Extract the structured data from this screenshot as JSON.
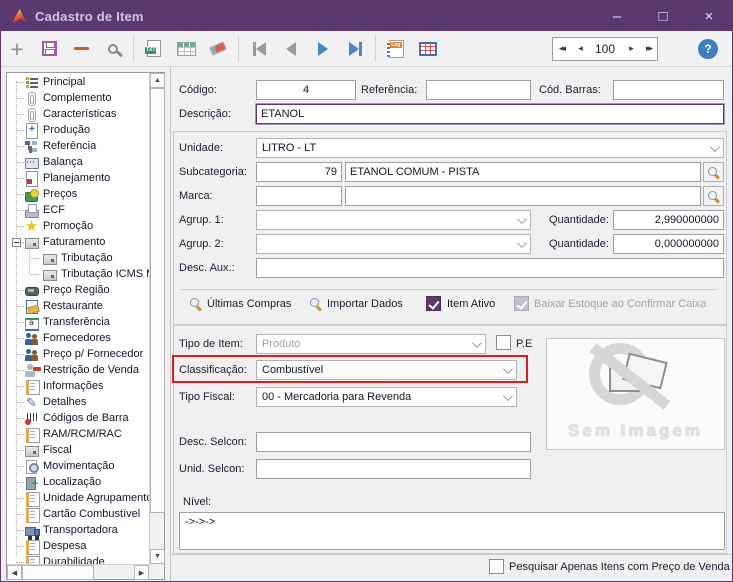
{
  "window": {
    "title": "Cadastro de Item",
    "minimize_glyph": "–",
    "maximize_glyph": "□",
    "close_glyph": "×"
  },
  "toolbar": {
    "spinner": {
      "first": "◂◂",
      "prev": "◂",
      "value": "100",
      "next": "▸",
      "last": "▸▸"
    },
    "help_glyph": "?"
  },
  "sidebar": {
    "items": [
      {
        "label": "Principal",
        "icon": "list-icon",
        "level": 0
      },
      {
        "label": "Complemento",
        "icon": "paperclip-icon",
        "level": 0
      },
      {
        "label": "Características",
        "icon": "paperclip-icon",
        "level": 0
      },
      {
        "label": "Produção",
        "icon": "production-doc-icon",
        "level": 0
      },
      {
        "label": "Referência",
        "icon": "hierarchy-icon",
        "level": 0
      },
      {
        "label": "Balança",
        "icon": "scale-icon",
        "level": 0
      },
      {
        "label": "Planejamento",
        "icon": "planning-doc-icon",
        "level": 0
      },
      {
        "label": "Preços",
        "icon": "money-icon",
        "level": 0
      },
      {
        "label": "ECF",
        "icon": "printer-icon",
        "level": 0
      },
      {
        "label": "Promoção",
        "icon": "star-icon",
        "level": 0,
        "star_glyph": "★"
      },
      {
        "label": "Faturamento",
        "icon": "invoice-icon",
        "level": 0,
        "expanded": true
      },
      {
        "label": "Tributação",
        "icon": "invoice-icon",
        "level": 1
      },
      {
        "label": "Tributação ICMS M",
        "icon": "invoice-icon",
        "level": 1
      },
      {
        "label": "Preço Região",
        "icon": "region-price-icon",
        "level": 0
      },
      {
        "label": "Restaurante",
        "icon": "restaurant-icon",
        "level": 0
      },
      {
        "label": "Transferência",
        "icon": "transfer-icon",
        "level": 0
      },
      {
        "label": "Fornecedores",
        "icon": "suppliers-icon",
        "level": 0
      },
      {
        "label": "Preço p/ Fornecedor",
        "icon": "suppliers-icon",
        "level": 0
      },
      {
        "label": "Restrição de Venda",
        "icon": "sale-restriction-icon",
        "level": 0
      },
      {
        "label": "Informações",
        "icon": "doc-icon",
        "level": 0
      },
      {
        "label": "Detalhes",
        "icon": "pencil-icon",
        "level": 0,
        "pencil_glyph": "✎"
      },
      {
        "label": "Códigos de Barra",
        "icon": "barcode-icon",
        "level": 0
      },
      {
        "label": "RAM/RCM/RAC",
        "icon": "doc-icon",
        "level": 0
      },
      {
        "label": "Fiscal",
        "icon": "invoice-icon",
        "level": 0
      },
      {
        "label": "Movimentação",
        "icon": "search-doc-icon",
        "level": 0
      },
      {
        "label": "Localização",
        "icon": "location-icon",
        "level": 0
      },
      {
        "label": "Unidade Agrupamento",
        "icon": "doc-icon",
        "level": 0
      },
      {
        "label": "Cartão Combustível",
        "icon": "doc-icon",
        "level": 0
      },
      {
        "label": "Transportadora",
        "icon": "truck-icon",
        "level": 0
      },
      {
        "label": "Despesa",
        "icon": "doc-icon",
        "level": 0
      },
      {
        "label": "Durabilidade",
        "icon": "doc-icon",
        "level": 0
      }
    ]
  },
  "form": {
    "codigo": {
      "label": "Código:",
      "value": "4"
    },
    "referencia": {
      "label": "Referência:",
      "value": ""
    },
    "cod_barras": {
      "label": "Cód. Barras:",
      "value": ""
    },
    "descricao": {
      "label": "Descrição:",
      "value": "ETANOL"
    },
    "unidade": {
      "label": "Unidade:",
      "value": "LITRO - LT"
    },
    "subcategoria": {
      "label": "Subcategoria:",
      "code": "79",
      "value": "ETANOL COMUM - PISTA"
    },
    "marca": {
      "label": "Marca:",
      "code": "",
      "value": ""
    },
    "agrup1": {
      "label": "Agrup. 1:",
      "value": "",
      "qty_label": "Quantidade:",
      "qty_value": "2,990000000"
    },
    "agrup2": {
      "label": "Agrup. 2:",
      "value": "",
      "qty_label": "Quantidade:",
      "qty_value": "0,000000000"
    },
    "desc_aux": {
      "label": "Desc. Aux.:",
      "value": ""
    },
    "ultimas_compras_label": "Últimas Compras",
    "importar_dados_label": "Importar Dados",
    "item_ativo": {
      "label": "Item Ativo",
      "checked": true
    },
    "baixar_estoque": {
      "label": "Baixar Estoque ao Confirmar Caixa",
      "checked": true,
      "disabled": true
    },
    "tipo_item": {
      "label": "Tipo de Item:",
      "value": "Produto",
      "disabled": true
    },
    "pe": {
      "label": "P.E",
      "checked": false
    },
    "classificacao": {
      "label": "Classificação:",
      "value": "Combustível",
      "highlighted": true
    },
    "tipo_fiscal": {
      "label": "Tipo Fiscal:",
      "value": "00 - Mercadoria para Revenda"
    },
    "desc_selcon": {
      "label": "Desc. Selcon:",
      "value": ""
    },
    "unid_selcon": {
      "label": "Unid. Selcon:",
      "value": ""
    },
    "nivel": {
      "label": "Nível:",
      "value": "->->->"
    },
    "sem_imagem_label": "Sem Imagem",
    "pesquisar": {
      "label": "Pesquisar Apenas Itens com Preço de Venda",
      "checked": false
    }
  },
  "colors": {
    "titlebar_purple": "#5a3971",
    "accent_purple": "#5a3971",
    "annotation_red": "#dd1c1c",
    "nav_blue": "#4a86c8",
    "help_blue": "#3d7ec4"
  }
}
